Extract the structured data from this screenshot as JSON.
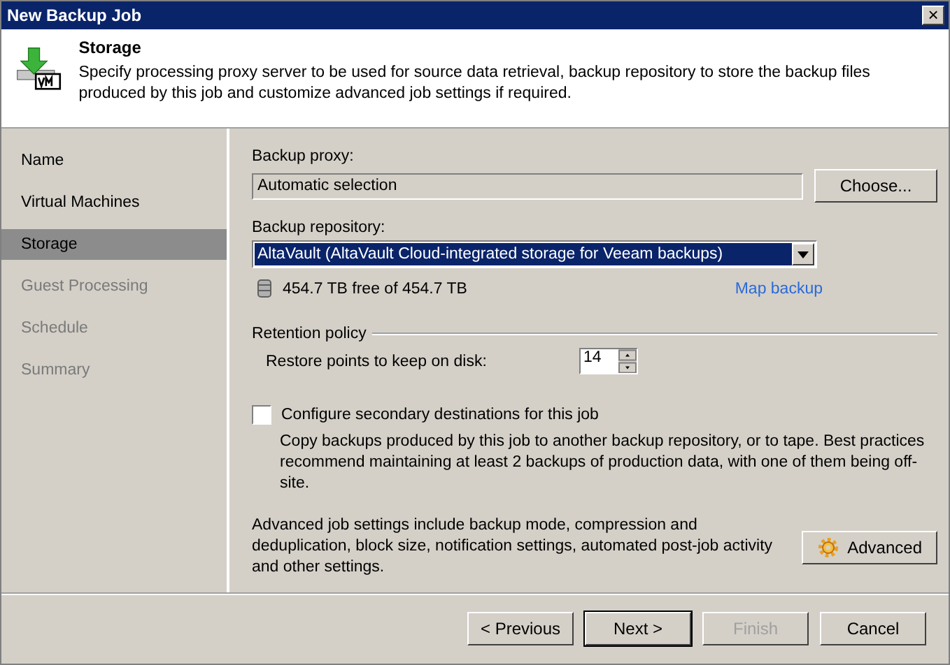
{
  "window": {
    "title": "New Backup Job",
    "close": "×"
  },
  "header": {
    "title": "Storage",
    "description": "Specify processing proxy server to be used for source data retrieval, backup repository to store the backup files produced by this job and customize advanced job settings if required."
  },
  "sidebar": {
    "items": [
      {
        "label": "Name",
        "selected": false,
        "disabled": false
      },
      {
        "label": "Virtual Machines",
        "selected": false,
        "disabled": false
      },
      {
        "label": "Storage",
        "selected": true,
        "disabled": false
      },
      {
        "label": "Guest Processing",
        "selected": false,
        "disabled": true
      },
      {
        "label": "Schedule",
        "selected": false,
        "disabled": true
      },
      {
        "label": "Summary",
        "selected": false,
        "disabled": true
      }
    ]
  },
  "proxy": {
    "label": "Backup proxy:",
    "value": "Automatic selection",
    "button": "Choose..."
  },
  "repository": {
    "label": "Backup repository:",
    "value": "AltaVault (AltaVault Cloud-integrated storage for Veeam backups)",
    "free": "454.7 TB free of 454.7 TB",
    "link": "Map backup"
  },
  "retention": {
    "title": "Retention policy",
    "label": "Restore points to keep on disk:",
    "value": "14"
  },
  "secondary": {
    "label": "Configure secondary destinations for this job",
    "checked": false,
    "description": "Copy backups produced by this job to another backup repository, or to tape. Best practices recommend maintaining at least 2 backups of production data, with one of them being off-site."
  },
  "advanced": {
    "description": "Advanced job settings include backup mode, compression and deduplication, block size, notification settings, automated post-job activity and other settings.",
    "button": "Advanced"
  },
  "buttons": [
    {
      "label": "< Previous",
      "disabled": false,
      "default": false
    },
    {
      "label": "Next >",
      "disabled": false,
      "default": true
    },
    {
      "label": "Finish",
      "disabled": true,
      "default": false
    },
    {
      "label": "Cancel",
      "disabled": false,
      "default": false
    }
  ]
}
